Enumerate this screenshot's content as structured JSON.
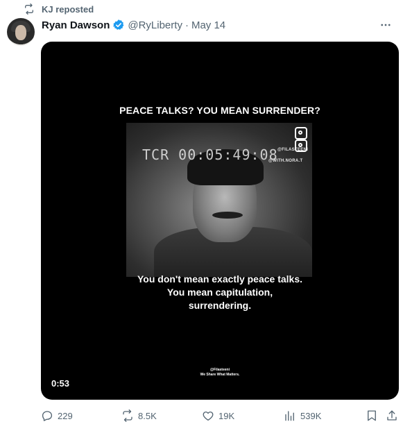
{
  "repost": {
    "text": "KJ reposted",
    "icon": "retweet-icon"
  },
  "author": {
    "name": "Ryan Dawson",
    "handle": "@RyLiberty",
    "separator": "·",
    "date": "May 14",
    "verified_color": "#1d9bf0"
  },
  "media": {
    "title_caption": "PEACE TALKS? YOU MEAN SURRENDER?",
    "timecode": "TCR 00:05:49:08",
    "tag_top": "@FILASTEENI",
    "tag_bottom": "@WITH.NORA.T",
    "subtitle_lines": [
      "You don't mean exactly peace talks.",
      "You mean capitulation,",
      "surrendering."
    ],
    "watermark_lines": [
      "@Filasteeni",
      "We Share What Matters."
    ],
    "duration": "0:53"
  },
  "actions": {
    "replies": "229",
    "reposts": "8.5K",
    "likes": "19K",
    "views": "539K"
  },
  "colors": {
    "muted": "#536471",
    "text": "#0f1419",
    "accent": "#1d9bf0"
  }
}
